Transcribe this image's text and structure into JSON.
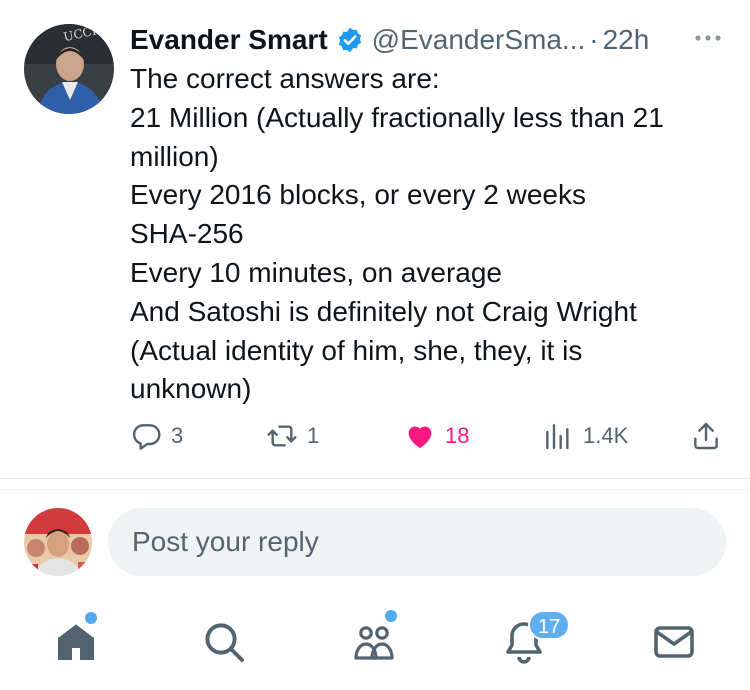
{
  "tweet": {
    "display_name": "Evander Smart",
    "handle": "@EvanderSma...",
    "separator": "·",
    "time": "22h",
    "lines": [
      "The correct answers are:",
      "21 Million (Actually fractionally less than 21",
      "million)",
      "Every 2016 blocks, or every 2 weeks",
      "SHA-256",
      "Every 10 minutes, on average",
      "And Satoshi is definitely not Craig Wright",
      "(Actual identity of him, she, they, it is",
      "unknown)"
    ],
    "avatar_text": "UCCI",
    "stats": {
      "replies": "3",
      "reposts": "1",
      "likes": "18",
      "views": "1.4K"
    }
  },
  "reply": {
    "placeholder": "Post your reply"
  },
  "nav": {
    "items": [
      "home",
      "search",
      "communities",
      "notifications",
      "messages"
    ],
    "notifications_badge": "17"
  },
  "colors": {
    "text": "#0f1419",
    "secondary": "#536471",
    "like": "#f91880",
    "verified": "#1d9bf0",
    "accent": "#5eaef0"
  }
}
